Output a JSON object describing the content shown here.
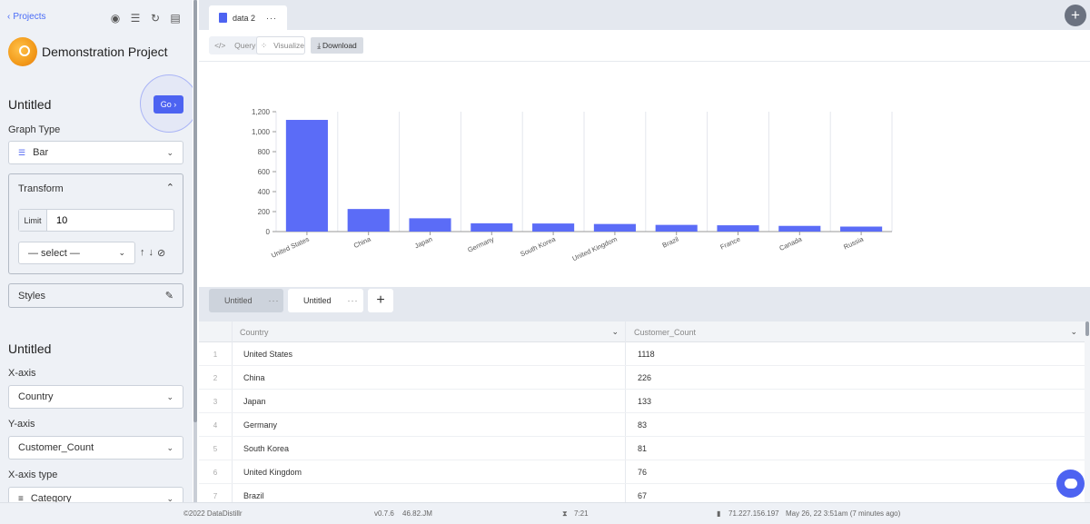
{
  "sidebar": {
    "back_label": "Projects",
    "project_title": "Demonstration Project",
    "section1_title": "Untitled",
    "go_label": "Go",
    "graph_type_label": "Graph Type",
    "graph_type_value": "Bar",
    "transform": {
      "title": "Transform",
      "limit_label": "Limit",
      "limit_value": "10",
      "select_value": "— select —"
    },
    "styles_label": "Styles",
    "section2_title": "Untitled",
    "xaxis_label": "X-axis",
    "xaxis_value": "Country",
    "yaxis_label": "Y-axis",
    "yaxis_value": "Customer_Count",
    "xaxis_type_label": "X-axis type",
    "xaxis_type_value": "Category"
  },
  "top_tab": {
    "label": "data 2",
    "more": "···"
  },
  "toolbar": {
    "query_label": "Query",
    "visualize_label": "Visualize",
    "download_label": "Download"
  },
  "chart_data": {
    "type": "bar",
    "categories": [
      "United States",
      "China",
      "Japan",
      "Germany",
      "South Korea",
      "United Kingdom",
      "Brazil",
      "France",
      "Canada",
      "Russia"
    ],
    "values": [
      1118,
      226,
      133,
      83,
      81,
      76,
      67,
      63,
      57,
      50
    ],
    "ylim": [
      0,
      1200
    ],
    "yticks": [
      "0",
      "200",
      "400",
      "600",
      "800",
      "1,000",
      "1,200"
    ],
    "color": "#5b6cf7",
    "grid": "vertical"
  },
  "bottom_tabs": [
    {
      "label": "Untitled",
      "more": "···"
    },
    {
      "label": "Untitled",
      "more": "···"
    }
  ],
  "add_tab": "+",
  "table": {
    "columns": [
      "Country",
      "Customer_Count"
    ],
    "rows": [
      {
        "n": "1",
        "country": "United States",
        "count": "1118"
      },
      {
        "n": "2",
        "country": "China",
        "count": "226"
      },
      {
        "n": "3",
        "country": "Japan",
        "count": "133"
      },
      {
        "n": "4",
        "country": "Germany",
        "count": "83"
      },
      {
        "n": "5",
        "country": "South Korea",
        "count": "81"
      },
      {
        "n": "6",
        "country": "United Kingdom",
        "count": "76"
      },
      {
        "n": "7",
        "country": "Brazil",
        "count": "67"
      }
    ]
  },
  "footer": {
    "copyright": "©2022 DataDistillr",
    "version": "v0.7.6",
    "build": "46.82.JM",
    "time": "7:21",
    "ip": "71.227.156.197",
    "updated": "May 26, 22 3:51am (7 minutes ago)"
  }
}
